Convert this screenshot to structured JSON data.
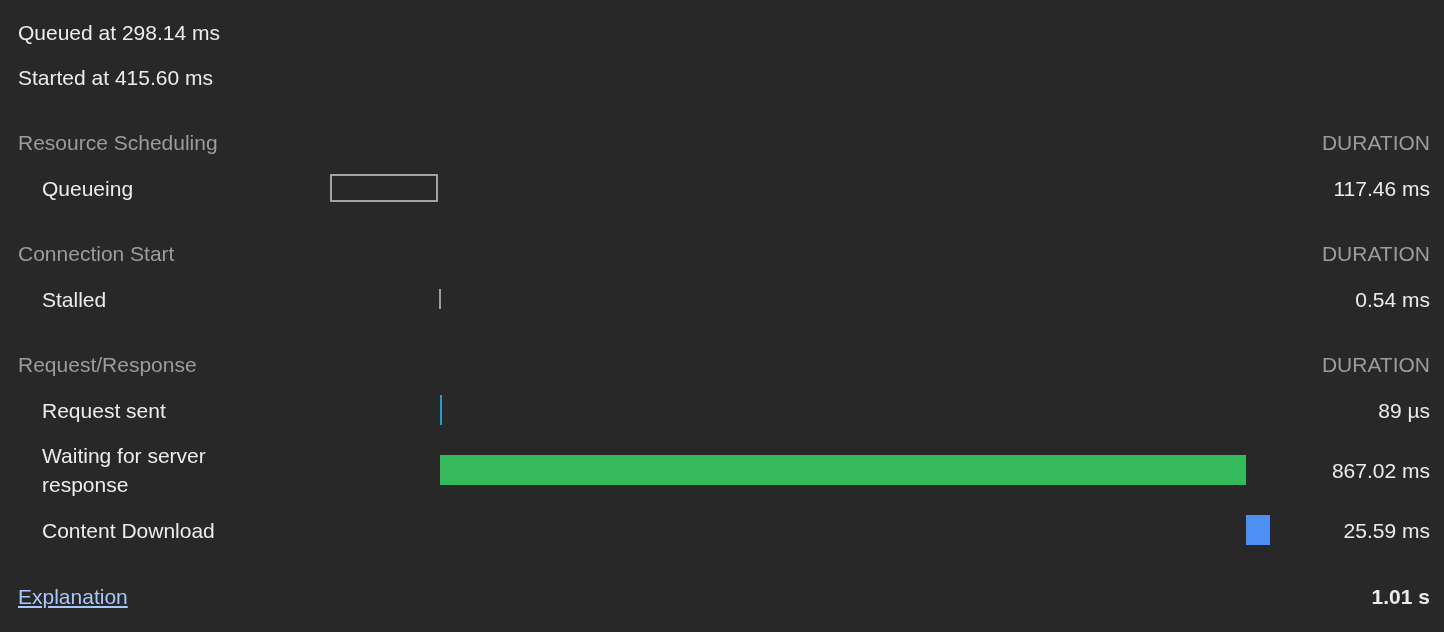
{
  "summary": [
    "Queued at 298.14 ms",
    "Started at 415.60 ms"
  ],
  "sections": [
    {
      "title": "Resource Scheduling",
      "column_label": "DURATION",
      "rows": [
        {
          "label": "Queueing",
          "duration": "117.46 ms",
          "bar": {
            "kind": "outline",
            "color": "#a3a3a3"
          }
        }
      ]
    },
    {
      "title": "Connection Start",
      "column_label": "DURATION",
      "rows": [
        {
          "label": "Stalled",
          "duration": "0.54 ms",
          "bar": {
            "kind": "fill",
            "color": "#9e9e9e"
          }
        }
      ]
    },
    {
      "title": "Request/Response",
      "column_label": "DURATION",
      "rows": [
        {
          "label": "Request sent",
          "duration": "89 µs",
          "bar": {
            "kind": "fill",
            "color": "#2a9ac0"
          }
        },
        {
          "label": "Waiting for server response",
          "duration": "867.02 ms",
          "bar": {
            "kind": "fill",
            "color": "#35ba5b"
          }
        },
        {
          "label": "Content Download",
          "duration": "25.59 ms",
          "bar": {
            "kind": "fill",
            "color": "#4d8ff2"
          }
        }
      ]
    }
  ],
  "footer": {
    "link": "Explanation",
    "total": "1.01 s"
  }
}
